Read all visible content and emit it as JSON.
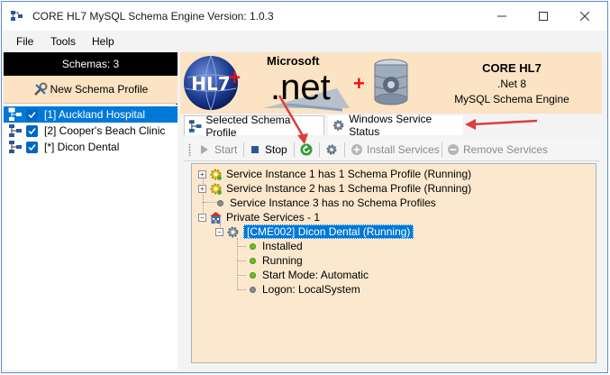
{
  "window": {
    "title": "CORE HL7 MySQL Schema Engine Version: 1.0.3"
  },
  "menu": {
    "items": [
      "File",
      "Tools",
      "Help"
    ]
  },
  "left_panel": {
    "schemas_header": "Schemas: 3",
    "new_profile_label": "New Schema Profile",
    "schemas": [
      {
        "label": "[1] Auckland Hospital",
        "checked": true,
        "selected": true
      },
      {
        "label": "[2] Cooper's Beach Clinic",
        "checked": true,
        "selected": false
      },
      {
        "label": "[*] Dicon Dental",
        "checked": true,
        "selected": false
      }
    ]
  },
  "banner": {
    "hl7_text": "HL7",
    "microsoft_text": "Microsoft",
    "net_text": ".net",
    "title": "CORE HL7",
    "subtitle1": ".Net 8",
    "subtitle2": "MySQL Schema Engine"
  },
  "tabs": {
    "selected_schema_profile": "Selected Schema Profile",
    "windows_service_status": "Windows Service Status"
  },
  "toolbar": {
    "start": "Start",
    "stop": "Stop",
    "install_services": "Install Services",
    "remove_services": "Remove Services"
  },
  "tree": {
    "instance1": "Service Instance 1 has 1 Schema Profile (Running)",
    "instance2": "Service Instance 2 has 1 Schema Profile (Running)",
    "instance3": "Service Instance 3 has no Schema Profiles",
    "private_services": "Private Services - 1",
    "service": "[CME002] Dicon Dental (Running)",
    "installed": "Installed",
    "running": "Running",
    "start_mode": "Start Mode: Automatic",
    "logon": "Logon: LocalSystem"
  },
  "colors": {
    "accent": "#0078d7",
    "banner_bg": "#fbe3c4",
    "tree_bg": "#fbe8cf",
    "arrow": "#e03c3c",
    "status_green": "#6fbe2a"
  }
}
